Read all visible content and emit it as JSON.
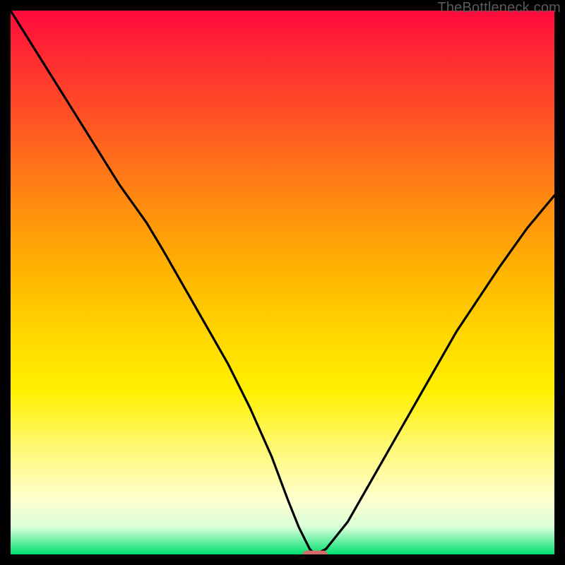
{
  "watermark": "TheBottleneck.com",
  "chart_data": {
    "type": "line",
    "title": "",
    "xlabel": "",
    "ylabel": "",
    "xlim": [
      0,
      100
    ],
    "ylim": [
      0,
      100
    ],
    "series": [
      {
        "name": "bottleneck-curve",
        "x": [
          0,
          5,
          10,
          15,
          20,
          25,
          28,
          32,
          36,
          40,
          44,
          48,
          51,
          53,
          55,
          56,
          58,
          62,
          66,
          70,
          74,
          78,
          82,
          86,
          90,
          95,
          100
        ],
        "values": [
          100,
          92,
          84,
          76,
          68,
          61,
          56,
          49,
          42,
          35,
          27,
          18,
          10,
          5,
          1,
          0,
          1,
          6,
          13,
          20,
          27,
          34,
          41,
          47,
          53,
          60,
          66
        ]
      }
    ],
    "marker": {
      "x": 56,
      "y": 0,
      "color": "#d96a6a",
      "width_pct": 4.5,
      "height_pct": 1.4
    },
    "background_gradient": {
      "top": "#ff0a3c",
      "mid": "#ffe000",
      "bottom": "#00e070"
    }
  }
}
